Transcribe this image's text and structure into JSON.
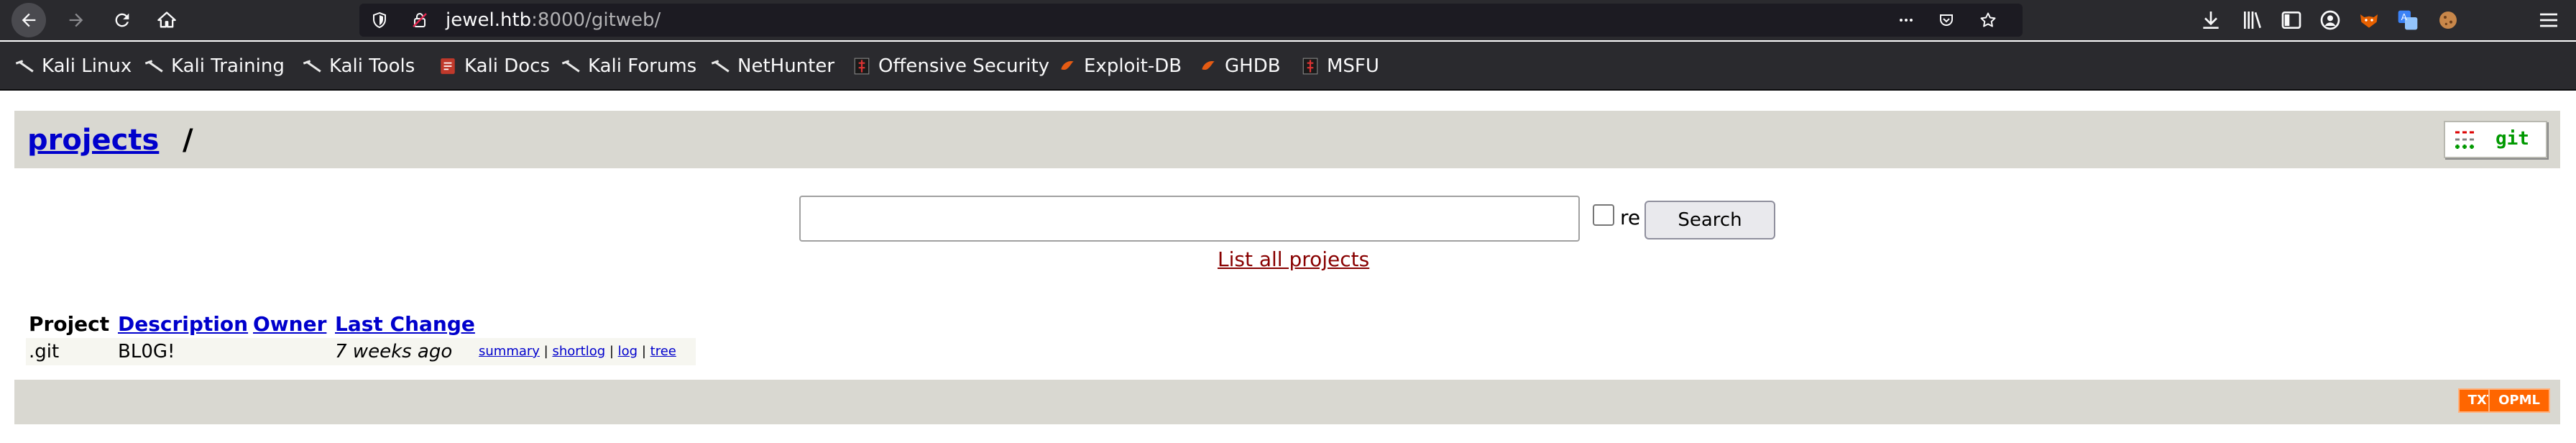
{
  "browser": {
    "url_host": "jewel.htb",
    "url_rest": ":8000/gitweb/",
    "bookmarks": [
      {
        "label": "Kali Linux",
        "icon": "kali-dragon-icon"
      },
      {
        "label": "Kali Training",
        "icon": "kali-dragon-icon"
      },
      {
        "label": "Kali Tools",
        "icon": "kali-dragon-icon"
      },
      {
        "label": "Kali Docs",
        "icon": "kali-docs-icon"
      },
      {
        "label": "Kali Forums",
        "icon": "kali-dragon-icon"
      },
      {
        "label": "NetHunter",
        "icon": "kali-dragon-icon"
      },
      {
        "label": "Offensive Security",
        "icon": "offsec-icon"
      },
      {
        "label": "Exploit-DB",
        "icon": "exploit-db-icon"
      },
      {
        "label": "GHDB",
        "icon": "ghdb-icon"
      },
      {
        "label": "MSFU",
        "icon": "msfu-icon"
      }
    ]
  },
  "gitweb": {
    "breadcrumb_link": "projects",
    "breadcrumb_sep": "/",
    "logo_text": "git",
    "search": {
      "value": "",
      "re_label": "re",
      "button_label": "Search",
      "list_all_label": "List all projects"
    },
    "table": {
      "headers": [
        "Project",
        "Description",
        "Owner",
        "Last Change"
      ],
      "rows": [
        {
          "project": ".git",
          "description": "BL0G!",
          "owner": "",
          "last_change": "7 weeks ago",
          "links": [
            "summary",
            "shortlog",
            "log",
            "tree"
          ]
        }
      ]
    },
    "footer": {
      "txt_label": "TXT",
      "opml_label": "OPML"
    }
  },
  "colors": {
    "toolbar_bg": "#2a2a2e",
    "page_header_bg": "#d9d8d1",
    "link_blue": "#0000cc",
    "list_all_red": "#880000",
    "feed_orange": "#ff6600"
  }
}
